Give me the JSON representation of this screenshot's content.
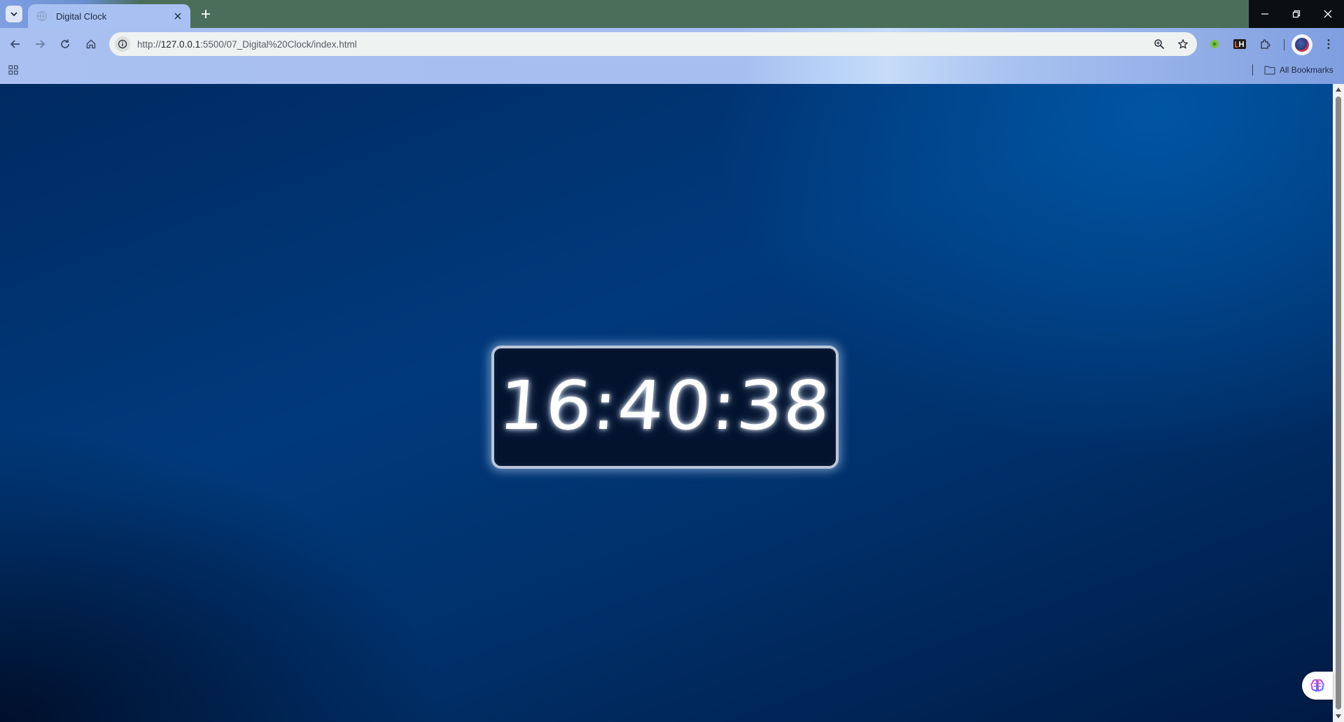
{
  "browser": {
    "tab": {
      "title": "Digital Clock"
    },
    "address_bar": {
      "url_prefix": "http://",
      "url_host": "127.0.0.1",
      "url_rest": ":5500/07_Digital%20Clock/index.html"
    },
    "bookmarks_bar": {
      "all_bookmarks_label": "All Bookmarks"
    },
    "extensions": [
      "green-circle-extension-icon",
      "lighthouse-extension-icon",
      "puzzle-extensions-icon"
    ],
    "colors": {
      "tab_strip": "#4a6e5a",
      "active_tab": "#a8c1f2",
      "window_controls": "#0b0f12"
    }
  },
  "page": {
    "clock": {
      "time": "16:40:38"
    },
    "colors": {
      "background_top": "#003a7c",
      "background_bottom": "#001a44",
      "clock_panel": "#03132e",
      "clock_border": "#b9c6d8",
      "clock_text": "#ffffff"
    }
  }
}
